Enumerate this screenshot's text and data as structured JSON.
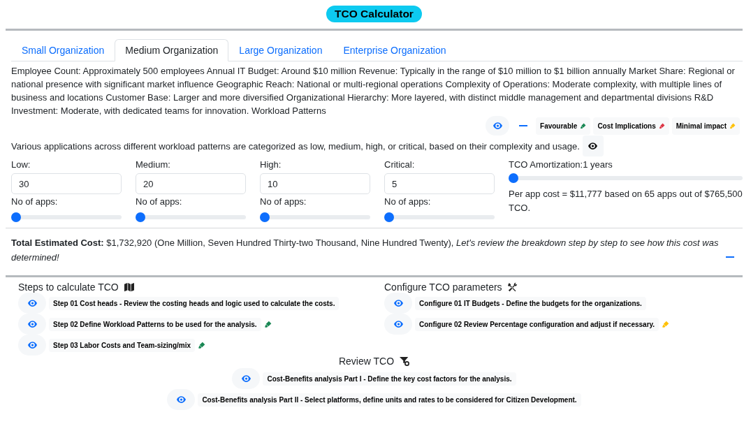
{
  "title": "TCO Calculator",
  "tabs": [
    {
      "label": "Small Organization",
      "selected": false
    },
    {
      "label": "Medium Organization",
      "selected": true
    },
    {
      "label": "Large Organization",
      "selected": false
    },
    {
      "label": "Enterprise Organization",
      "selected": false
    }
  ],
  "description": "Employee Count: Approximately 500 employees Annual IT Budget: Around $10 million Revenue: Typically in the range of $10 million to $1 billion annually Market Share: Regional or national presence with significant market influence Geographic Reach: National or multi-regional operations Complexity of Operations: Moderate complexity, with multiple lines of business and locations Customer Base: Larger and more diversified Organizational Hierarchy: More layered, with distinct middle management and departmental divisions R&D Investment: Moderate, with dedicated teams for innovation. Workload Patterns",
  "legend": [
    {
      "label": "Favourable",
      "color": "#198754"
    },
    {
      "label": "Cost Implications",
      "color": "#dc3545"
    },
    {
      "label": "Minimal impact",
      "color": "#ffc107"
    }
  ],
  "categories_note": "Various applications across different workload patterns are categorized as low, medium, high, or critical, based on their complexity and usage.",
  "workloads": [
    {
      "label": "Low:",
      "value": "30",
      "apps_label": "No of apps:",
      "level": 0
    },
    {
      "label": "Medium:",
      "value": "20",
      "apps_label": "No of apps:",
      "level": 0
    },
    {
      "label": "High:",
      "value": "10",
      "apps_label": "No of apps:",
      "level": 0
    },
    {
      "label": "Critical:",
      "value": "5",
      "apps_label": "No of apps:",
      "level": 0
    }
  ],
  "amortization": {
    "label": "TCO Amortization:1 years",
    "level": 0,
    "per_app_cost": "Per app cost = $11,777 based on 65 apps out of $765,500 TCO."
  },
  "total": "**Total Estimated Cost:** $1,732,920 (One Million, Seven Hundred Thirty-two Thousand, Nine Hundred Twenty), *Let's review the breakdown step by step to see how this cost was determined!*",
  "steps": {
    "heading": "Steps to calculate TCO",
    "items": [
      {
        "text": "Step 01 Cost heads - Review the costing heads and logic used to calculate the costs."
      },
      {
        "text": "Step 02 Define Workload Patterns to be used for the analysis.",
        "color": "#198754"
      },
      {
        "text": "Step 03 Labor Costs and Team-sizing/mix",
        "color": "#198754"
      }
    ]
  },
  "configure": {
    "heading": "Configure TCO parameters",
    "items": [
      {
        "text": "Configure 01 IT Budgets - Define the budgets for the organizations."
      },
      {
        "text": "Configure 02 Review Percentage configuration and adjust if necessary.",
        "color": "#ffc107"
      }
    ]
  },
  "review": {
    "heading": "Review TCO",
    "items": [
      {
        "text": "Cost-Benefits analysis Part I - Define the key cost factors for the analysis."
      },
      {
        "text": "Cost-Benefits analysis Part II - Select platforms, define units and rates to be considered for Citizen Development."
      }
    ]
  }
}
